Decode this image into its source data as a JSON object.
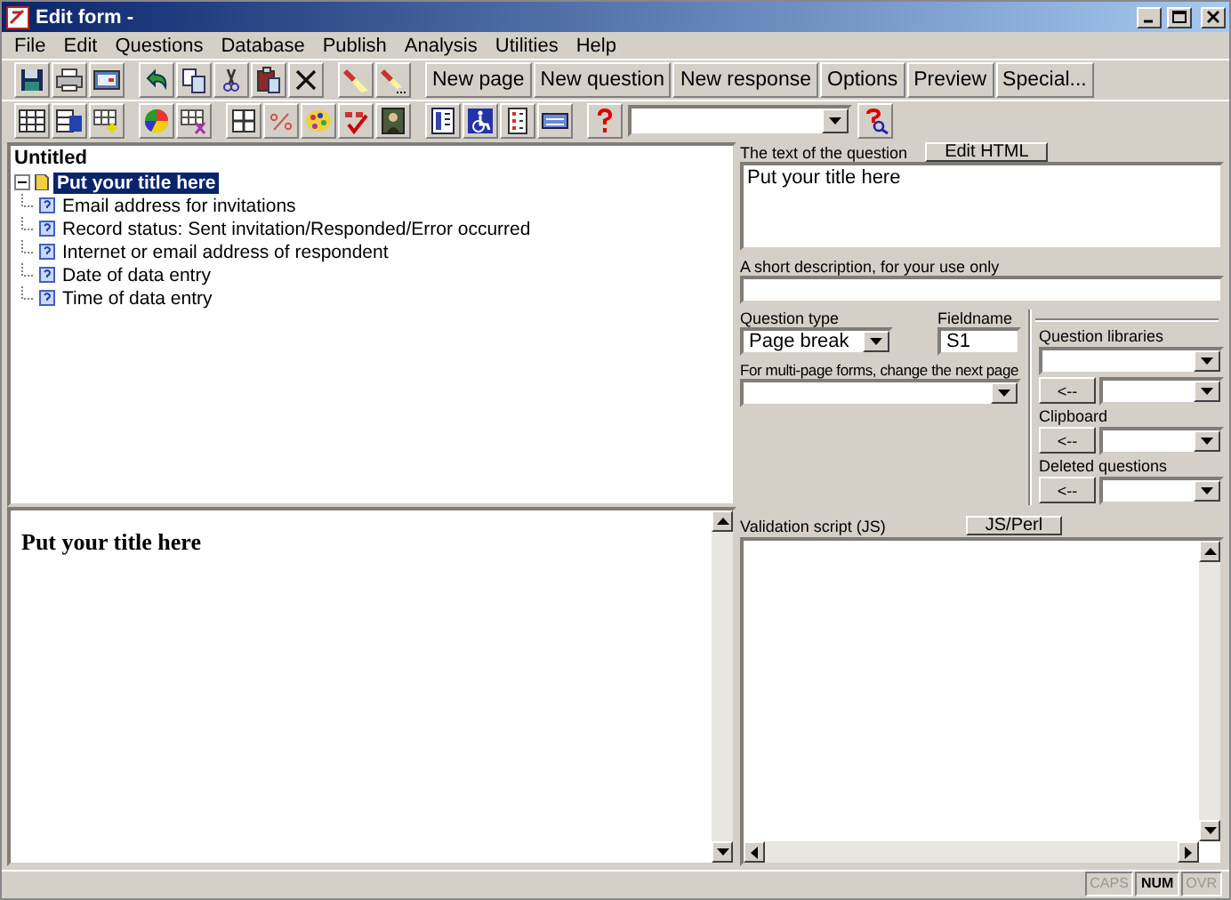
{
  "window": {
    "title": "Edit form -"
  },
  "menu": [
    "File",
    "Edit",
    "Questions",
    "Database",
    "Publish",
    "Analysis",
    "Utilities",
    "Help"
  ],
  "toolbar_buttons": [
    "New page",
    "New question",
    "New response",
    "Options",
    "Preview",
    "Special..."
  ],
  "tree": {
    "root": "Untitled",
    "items": [
      {
        "label": "Put your title here",
        "selected": true,
        "expanded": true,
        "children": [
          {
            "label": "Email address for invitations",
            "selected": false
          },
          {
            "label": "Record status: Sent invitation/Responded/Error occurred",
            "selected": false
          },
          {
            "label": "Internet or email address of respondent",
            "selected": false
          },
          {
            "label": "Date of data entry",
            "selected": false
          },
          {
            "label": "Time of data entry",
            "selected": false
          }
        ]
      }
    ]
  },
  "preview": {
    "heading": "Put your title here"
  },
  "question_text": {
    "label": "The text of the question",
    "button": "Edit HTML",
    "value": "Put your title here"
  },
  "short_description": {
    "label": "A short description, for your use only"
  },
  "question_type": {
    "label": "Question type",
    "value": "Page break"
  },
  "fieldname": {
    "label": "Fieldname",
    "value": "S1"
  },
  "next_page": {
    "label": "For multi-page forms, change the next page"
  },
  "libraries": [
    {
      "label": "Question libraries",
      "button": "<--"
    },
    {
      "label": "Clipboard",
      "button": "<--"
    },
    {
      "label": "Deleted questions",
      "button": "<--"
    }
  ],
  "validation": {
    "label": "Validation script (JS)",
    "button": "JS/Perl"
  },
  "status_bar": [
    {
      "label": "CAPS",
      "on": false
    },
    {
      "label": "NUM",
      "on": true
    },
    {
      "label": "OVR",
      "on": false
    }
  ]
}
